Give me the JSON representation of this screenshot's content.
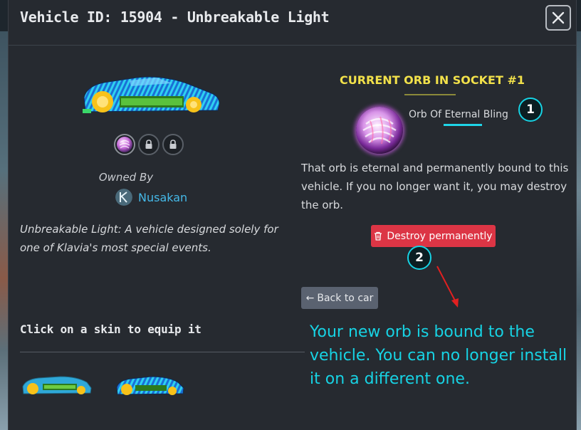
{
  "modal": {
    "title": "Vehicle ID: 15904 - Unbreakable Light",
    "close_icon": "close-icon"
  },
  "vehicle": {
    "owned_by_label": "Owned By",
    "owner_name": "Nusakan",
    "description": "Unbreakable Light: A vehicle designed solely for one of Klavia's most special events.",
    "sockets": [
      {
        "state": "orb"
      },
      {
        "state": "locked",
        "icon": "lock-icon"
      },
      {
        "state": "locked",
        "icon": "lock-icon"
      }
    ]
  },
  "skins": {
    "heading": "Click on a skin to equip it"
  },
  "orb_panel": {
    "heading": "CURRENT ORB IN SOCKET #1",
    "orb_name": "Orb Of Eternal Bling",
    "message": "That orb is eternal and permanently bound to this vehicle. If you no longer want it, you may destroy the orb.",
    "destroy_label": "Destroy permanently",
    "destroy_icon": "trash-icon",
    "back_label": "Back to car",
    "back_icon": "arrow-left-icon"
  },
  "annotations": {
    "badge_1": "1",
    "badge_2": "2",
    "note": "Your new orb is bound to the vehicle. You can no longer install it on a different one."
  },
  "colors": {
    "accent_yellow": "#f2e14a",
    "link_blue": "#45b9e8",
    "danger_red": "#dc3545",
    "annotation_cyan": "#17d3e4"
  }
}
